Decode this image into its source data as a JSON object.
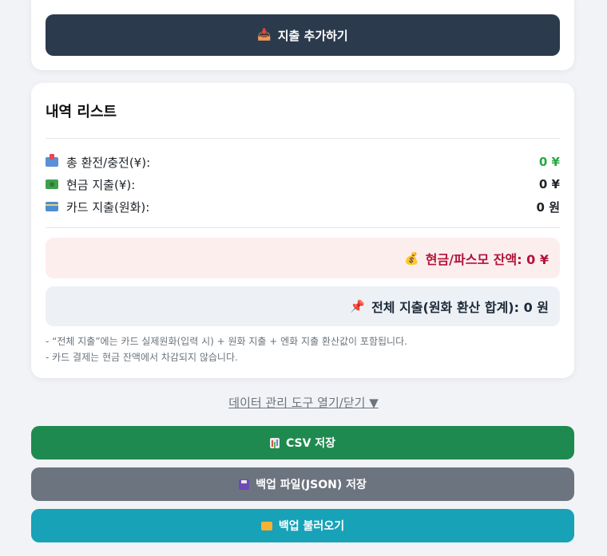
{
  "add_button": {
    "icon": "inbox-tray-icon",
    "label": "지출 추가하기"
  },
  "list": {
    "title": "내역 리스트",
    "rows": [
      {
        "icon": "inbox-tray-icon",
        "label": "총 환전/충전(¥):",
        "value": "0 ¥",
        "color": "#28a745"
      },
      {
        "icon": "cash-icon",
        "label": "현금 지출(¥):",
        "value": "0 ¥"
      },
      {
        "icon": "credit-card-icon",
        "label": "카드 지출(원화):",
        "value": "0 원"
      }
    ],
    "balance": {
      "icon": "money-bag-icon",
      "text": "현금/파스모 잔액: 0 ¥",
      "emoji": "💰"
    },
    "total": {
      "icon": "pushpin-icon",
      "text": "전체 지출(원화 환산 합계): 0 원",
      "emoji": "📌"
    },
    "notes": [
      "- “전체 지출”에는 카드 실제원화(입력 시) + 원화 지출 + 엔화 지출 환산값이 포함됩니다.",
      "- 카드 결제는 현금 잔액에서 차감되지 않습니다."
    ]
  },
  "data_tools_toggle": "데이터 관리 도구 열기/닫기 ▼",
  "buttons": {
    "csv": {
      "icon": "bar-chart-icon",
      "label": "CSV 저장"
    },
    "json": {
      "icon": "floppy-disk-icon",
      "label": "백업 파일(JSON) 저장"
    },
    "load": {
      "icon": "folder-icon",
      "label": "백업 불러오기"
    }
  },
  "colors": {
    "add_button": "#2c3a4d",
    "csv_button": "#1f8a4f",
    "json_button": "#6c747f",
    "load_button": "#17a2b8",
    "balance_text": "#b3123a",
    "positive": "#28a745"
  }
}
